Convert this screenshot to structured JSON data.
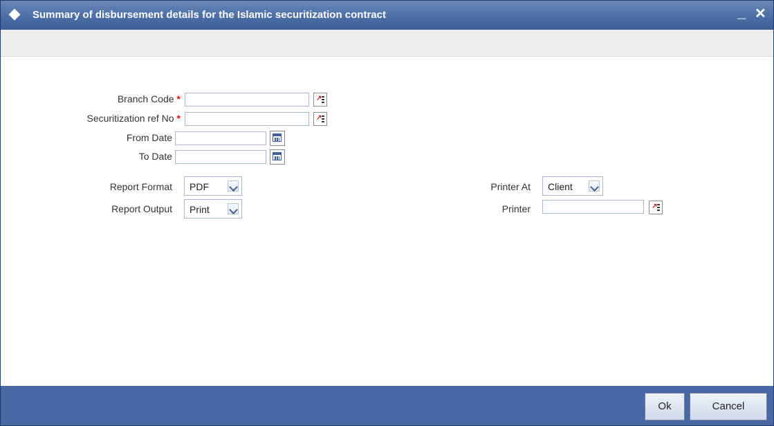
{
  "window": {
    "title": "Summary of disbursement details for the Islamic securitization contract",
    "minimize_label": "_",
    "close_label": "✕"
  },
  "form": {
    "branch_code": {
      "label": "Branch Code",
      "required_mark": "*",
      "value": ""
    },
    "securitization_ref_no": {
      "label": "Securitization ref No",
      "required_mark": "*",
      "value": ""
    },
    "from_date": {
      "label": "From Date",
      "value": ""
    },
    "to_date": {
      "label": "To Date",
      "value": ""
    },
    "report_format": {
      "label": "Report Format",
      "selected": "PDF"
    },
    "report_output": {
      "label": "Report Output",
      "selected": "Print"
    },
    "printer_at": {
      "label": "Printer At",
      "selected": "Client"
    },
    "printer": {
      "label": "Printer",
      "value": ""
    }
  },
  "buttons": {
    "ok": "Ok",
    "cancel": "Cancel"
  },
  "colors": {
    "title_bar": "#4a6ca4",
    "footer": "#4967a4",
    "required": "#dd1111"
  },
  "icons": {
    "title": "diamond-icon",
    "lov": "lov-search-icon",
    "calendar": "calendar-icon",
    "dropdown": "chevron-down-icon"
  }
}
